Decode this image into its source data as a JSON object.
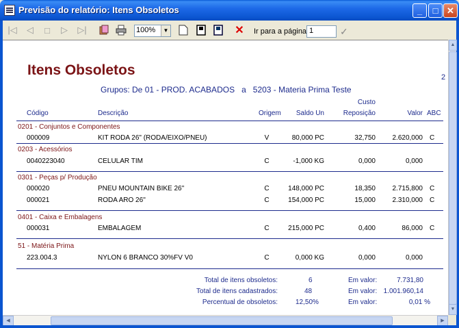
{
  "window": {
    "title": "Previsão do relatório: Itens Obsoletos",
    "buttons": {
      "minimize": "_",
      "maximize": "□",
      "close": "✕"
    }
  },
  "toolbar": {
    "zoom": "100%",
    "goto_label": "Ir para a página",
    "goto_value": "1"
  },
  "report": {
    "title": "Itens Obsoletos",
    "page_number": "2",
    "subtitle_parts": [
      "Grupos: De 01 - PROD. ACABADOS",
      "a",
      "5203 - Materia Prima Teste"
    ],
    "columns": {
      "codigo": "Código",
      "descricao": "Descrição",
      "origem": "Origem",
      "saldo": "Saldo Un",
      "custo_top": "Custo",
      "custo_bottom": "Reposição",
      "valor": "Valor",
      "abc": "ABC"
    },
    "groups": [
      {
        "name": "0201 - Conjuntos e Componentes",
        "rows": [
          {
            "codigo": "000009",
            "descricao": "KIT RODA 26\" (RODA/EIXO/PNEU)",
            "origem": "V",
            "saldo": "80,000 PC",
            "custo": "32,750",
            "valor": "2.620,000",
            "abc": "C"
          }
        ]
      },
      {
        "name": "0203 - Acessórios",
        "rows": [
          {
            "codigo": "0040223040",
            "descricao": "CELULAR TIM",
            "origem": "C",
            "saldo": "-1,000 KG",
            "custo": "0,000",
            "valor": "0,000",
            "abc": ""
          }
        ]
      },
      {
        "name": "0301 - Peças p/ Produção",
        "rows": [
          {
            "codigo": "000020",
            "descricao": "PNEU MOUNTAIN BIKE 26''",
            "origem": "C",
            "saldo": "148,000 PC",
            "custo": "18,350",
            "valor": "2.715,800",
            "abc": "C"
          },
          {
            "codigo": "000021",
            "descricao": "RODA ARO 26''",
            "origem": "C",
            "saldo": "154,000 PC",
            "custo": "15,000",
            "valor": "2.310,000",
            "abc": "C"
          }
        ]
      },
      {
        "name": "0401 - Caixa e Embalagens",
        "rows": [
          {
            "codigo": "000031",
            "descricao": "EMBALAGEM",
            "origem": "C",
            "saldo": "215,000 PC",
            "custo": "0,400",
            "valor": "86,000",
            "abc": "C"
          }
        ]
      },
      {
        "name": "51 - Matéria Prima",
        "rows": [
          {
            "codigo": "223.004.3",
            "descricao": "NYLON 6 BRANCO 30%FV V0",
            "origem": "C",
            "saldo": "0,000 KG",
            "custo": "0,000",
            "valor": "0,000",
            "abc": ""
          }
        ]
      }
    ],
    "totals": [
      {
        "label": "Total de itens obsoletos:",
        "value": "6",
        "label2": "Em valor:",
        "value2": "7.731,80"
      },
      {
        "label": "Total de itens cadastrados:",
        "value": "48",
        "label2": "Em valor:",
        "value2": "1.001.960,14"
      },
      {
        "label": "Percentual de obsoletos:",
        "value": "12,50%",
        "label2": "Em valor:",
        "value2": "0,01 %"
      }
    ]
  },
  "icons": [
    "first-page-icon",
    "prev-page-icon",
    "stop-icon",
    "next-page-icon",
    "last-page-icon",
    "print-setup-icon",
    "print-icon",
    "page-width-icon",
    "whole-page-icon",
    "two-pages-icon",
    "close-preview-icon",
    "go-icon"
  ]
}
